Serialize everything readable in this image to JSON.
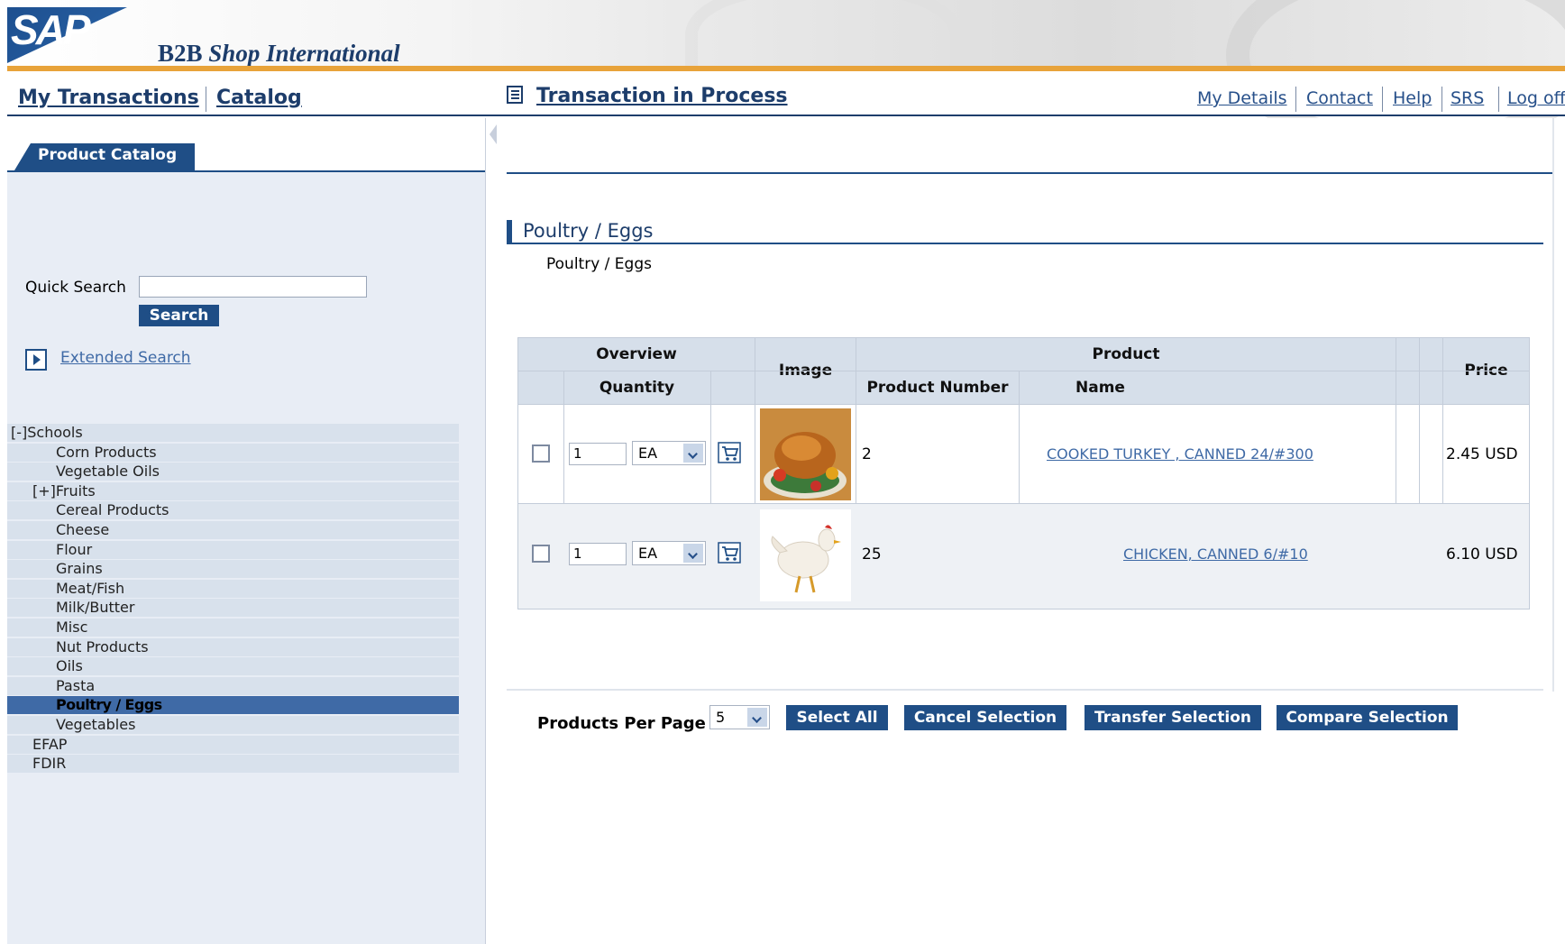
{
  "header": {
    "logo_text": "SAP",
    "title_main": "B2B",
    "title_italic": "Shop International"
  },
  "nav": {
    "my_transactions": "My Transactions",
    "catalog": "Catalog",
    "transaction_in_process": "Transaction in Process",
    "utility_links": [
      "My Details",
      "Contact",
      "Help",
      "SRS",
      "Log off"
    ]
  },
  "left": {
    "tab_label": "Product Catalog",
    "quick_search_label": "Quick Search",
    "quick_search_value": "",
    "search_button": "Search",
    "extended_search": "Extended Search",
    "tree": [
      {
        "label": "[-]Schools",
        "level": 0
      },
      {
        "label": "Corn Products",
        "level": 2
      },
      {
        "label": "Vegetable Oils",
        "level": 2
      },
      {
        "label": "[+]Fruits",
        "level": 1
      },
      {
        "label": "Cereal Products",
        "level": 2
      },
      {
        "label": "Cheese",
        "level": 2
      },
      {
        "label": "Flour",
        "level": 2
      },
      {
        "label": "Grains",
        "level": 2
      },
      {
        "label": "Meat/Fish",
        "level": 2
      },
      {
        "label": "Milk/Butter",
        "level": 2
      },
      {
        "label": "Misc",
        "level": 2
      },
      {
        "label": "Nut Products",
        "level": 2
      },
      {
        "label": "Oils",
        "level": 2
      },
      {
        "label": "Pasta",
        "level": 2
      },
      {
        "label": "Poultry / Eggs",
        "level": 2,
        "selected": true
      },
      {
        "label": "Vegetables",
        "level": 2
      },
      {
        "label": "EFAP",
        "level": 1
      },
      {
        "label": "FDIR",
        "level": 1
      }
    ]
  },
  "main": {
    "category_heading": "Poultry / Eggs",
    "category_sub": "Poultry / Eggs",
    "table": {
      "header_overview": "Overview",
      "header_quantity": "Quantity",
      "header_image": "Image",
      "header_product": "Product",
      "header_product_number": "Product Number",
      "header_name": "Name",
      "header_price": "Price",
      "rows": [
        {
          "qty": "1",
          "uom": "EA",
          "number": "2",
          "name": "COOKED TURKEY , CANNED 24/#300",
          "price": "2.45 USD"
        },
        {
          "qty": "1",
          "uom": "EA",
          "number": "25",
          "name": "CHICKEN, CANNED 6/#10",
          "price": "6.10 USD"
        }
      ]
    },
    "products_per_page_label": "Products Per Page",
    "products_per_page_value": "5",
    "buttons": {
      "select_all": "Select All",
      "cancel_selection": "Cancel Selection",
      "transfer_selection": "Transfer Selection",
      "compare_selection": "Compare Selection"
    }
  },
  "colors": {
    "brand_blue": "#1f4e86",
    "accent_orange": "#e8a33a",
    "tree_bg": "#d8e1ec",
    "tree_selected": "#3f6aa6"
  }
}
